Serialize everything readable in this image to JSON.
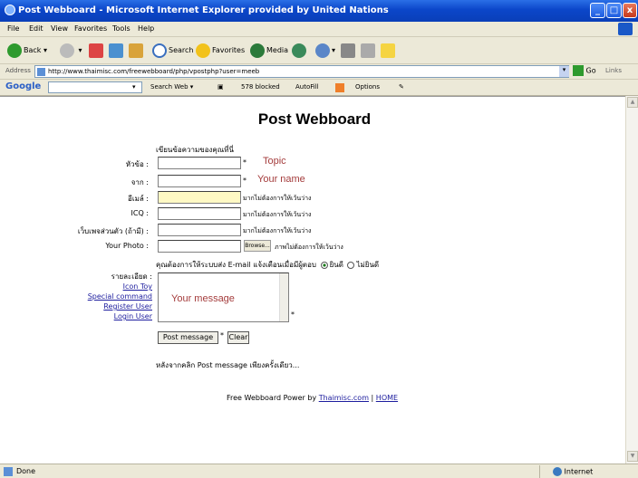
{
  "window": {
    "title": "Post Webboard - Microsoft Internet Explorer provided by United Nations"
  },
  "menu": [
    "File",
    "Edit",
    "View",
    "Favorites",
    "Tools",
    "Help"
  ],
  "toolbar": {
    "back": "Back",
    "search": "Search",
    "favorites": "Favorites",
    "media": "Media"
  },
  "address": {
    "label": "Address",
    "url": "http://www.thaimisc.com/freewebboard/php/vpostphp?user=meeb",
    "go": "Go",
    "links": "Links"
  },
  "google": {
    "logo": "Google",
    "search_web": "Search Web",
    "blocked": "578 blocked",
    "autofill": "AutoFill",
    "options": "Options"
  },
  "page": {
    "title": "Post Webboard",
    "hint": "เขียนข้อความของคุณที่นี่",
    "fields": [
      {
        "label": "หัวข้อ :",
        "value": "",
        "note": "*"
      },
      {
        "label": "จาก :",
        "value": "",
        "note": "*"
      },
      {
        "label": "อีเมล์ :",
        "value": "",
        "note": "มากไม่ต้องการให้เว้นว่าง"
      },
      {
        "label": "ICQ :",
        "value": "",
        "note": "มากไม่ต้องการให้เว้นว่าง"
      },
      {
        "label": "เว็บเพจส่วนตัว (ถ้ามี) :",
        "value": "",
        "note": "มากไม่ต้องการให้เว้นว่าง"
      },
      {
        "label": "Your Photo :",
        "value": "",
        "note": "ภาพไม่ต้องการให้เว้นว่าง"
      }
    ],
    "browse_label": "Browse...",
    "annotations": {
      "topic": "Topic",
      "name": "Your name",
      "message": "Your message"
    },
    "email_question": "คุณต้องการให้ระบบส่ง E-mail แจ้งเตือนเมื่อมีผู้ตอบ",
    "email_yes": "ยินดี",
    "email_no": "ไม่ยินดี",
    "detail_label": "รายละเอียด :",
    "side_links": [
      "Icon Toy",
      "Special command",
      "Register User",
      "Login User"
    ],
    "textarea_star": "*",
    "post_button": "Post message",
    "clear_button": "Clear",
    "info": "หลังจากคลิก Post message เพียงครั้งเดียว...",
    "footer_prefix": "Free Webboard Power by",
    "footer_link": "Thaimisc.com",
    "footer_sep": "|",
    "footer_home": "HOME"
  },
  "status": {
    "text": "Done",
    "zone": "Internet"
  }
}
